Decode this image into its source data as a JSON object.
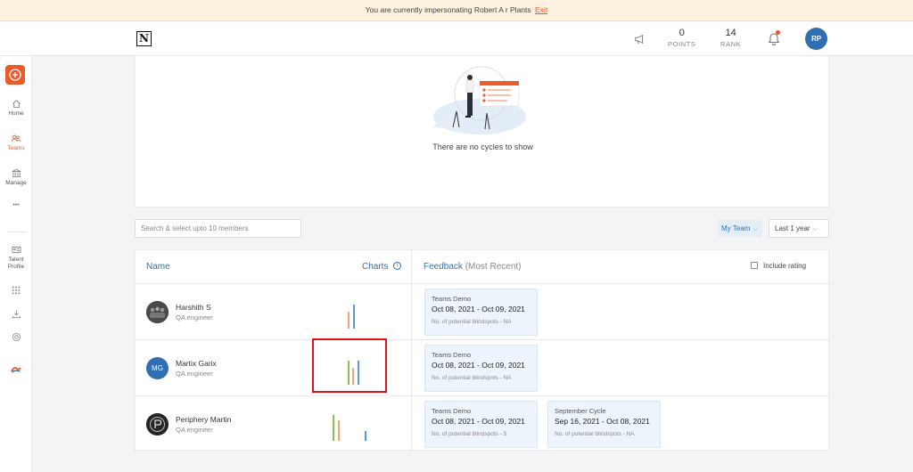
{
  "banner": {
    "text": "You are currently impersonating Robert A r Plants",
    "exit_label": "Exit"
  },
  "header": {
    "logo_letter": "N",
    "points": {
      "value": "0",
      "label": "POINTS"
    },
    "rank": {
      "value": "14",
      "label": "RANK"
    },
    "avatar_initials": "RP"
  },
  "sidebar": {
    "items": [
      {
        "label": "Home",
        "icon": "home-icon"
      },
      {
        "label": "Teams",
        "icon": "teams-icon"
      },
      {
        "label": "Manage",
        "icon": "bank-icon"
      },
      {
        "label": "•••",
        "icon": "more-icon"
      },
      {
        "label": "Talent Profile",
        "icon": "id-card-icon"
      },
      {
        "label": "",
        "icon": "grid-icon"
      },
      {
        "label": "",
        "icon": "download-icon"
      },
      {
        "label": "",
        "icon": "support-icon"
      },
      {
        "label": "",
        "icon": "brand-icon"
      }
    ]
  },
  "cycles": {
    "empty_text": "There are no cycles to show"
  },
  "filters": {
    "search_placeholder": "Search & select upto 10 members",
    "team_select": "My Team",
    "period_select": "Last 1 year"
  },
  "table": {
    "headers": {
      "name": "Name",
      "charts": "Charts",
      "info": "i",
      "feedback": "Feedback",
      "feedback_sub": "(Most Recent)",
      "include_rating": "Include rating"
    },
    "rows": [
      {
        "name": "Harshith S",
        "role": "QA engineer",
        "avatar_initials": "",
        "chart_values": [
          0.62,
          0,
          0.9
        ],
        "feedback": [
          {
            "cycle": "Teams Demo",
            "dates": "Oct 08, 2021 - Oct 09, 2021",
            "blindspots": "No. of potential blindspots - NA"
          }
        ]
      },
      {
        "name": "Martix Garix",
        "role": "QA engineer",
        "avatar_initials": "MG",
        "chart_values": [
          0.9,
          0.62,
          0.9
        ],
        "feedback": [
          {
            "cycle": "Teams Demo",
            "dates": "Oct 08, 2021 - Oct 09, 2021",
            "blindspots": "No. of potential blindspots - NA"
          }
        ]
      },
      {
        "name": "Periphery Martin",
        "role": "QA engineer",
        "avatar_initials": "",
        "chart_values": [
          0.95,
          0.75,
          0.35
        ],
        "feedback": [
          {
            "cycle": "Teams Demo",
            "dates": "Oct 08, 2021 - Oct 09, 2021",
            "blindspots": "No. of potential blindspots - 5"
          },
          {
            "cycle": "September Cycle",
            "dates": "Sep 16, 2021 - Oct 08, 2021",
            "blindspots": "No. of potential blindspots - NA"
          }
        ]
      }
    ]
  },
  "colors": {
    "accent": "#ec5a2a",
    "primary": "#2f6fb2",
    "bar_green": "#8bc34a",
    "bar_orange": "#f0a57c",
    "bar_blue": "#5b9bd5",
    "highlight": "#e0131b"
  }
}
